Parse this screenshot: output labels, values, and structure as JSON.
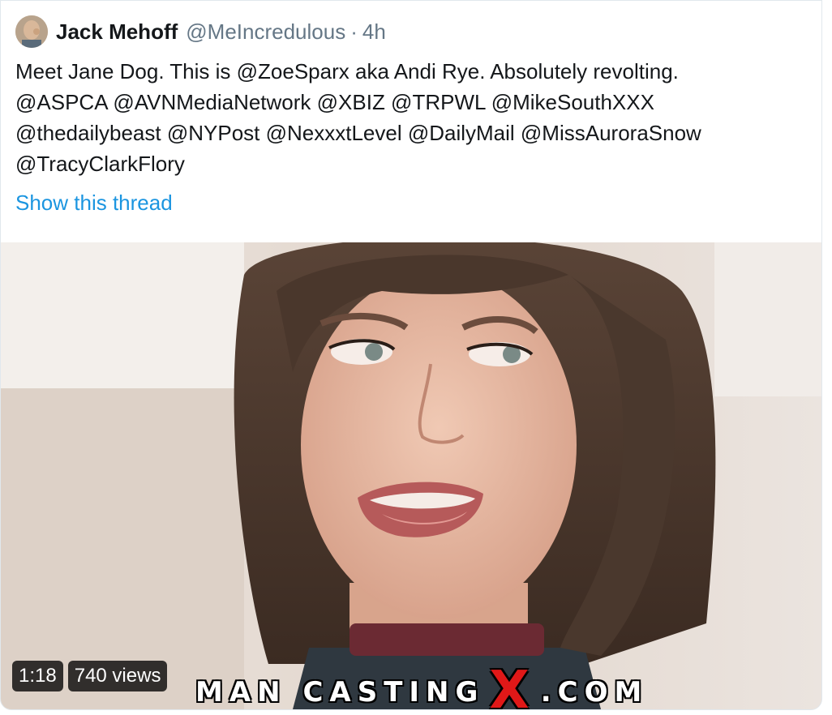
{
  "tweet": {
    "author_name": "Jack Mehoff",
    "author_handle": "@MeIncredulous",
    "separator": "·",
    "time": "4h",
    "text_lines": [
      "Meet Jane Dog. This is @ZoeSparx aka Andi Rye. Absolutely revolting.",
      "@ASPCA @AVNMediaNetwork @XBIZ @TRPWL @MikeSouthXXX",
      "@thedailybeast @NYPost @NexxxtLevel @DailyMail @MissAuroraSnow",
      "@TracyClarkFlory"
    ],
    "show_thread": "Show this thread"
  },
  "media": {
    "duration": "1:18",
    "views": "740 views",
    "watermark_left": "MAN CASTING",
    "watermark_x": "X",
    "watermark_right": ".COM"
  },
  "colors": {
    "link": "#1b95e0",
    "secondary_text": "#657786",
    "primary_text": "#14171a",
    "watermark_x": "#e01818"
  }
}
